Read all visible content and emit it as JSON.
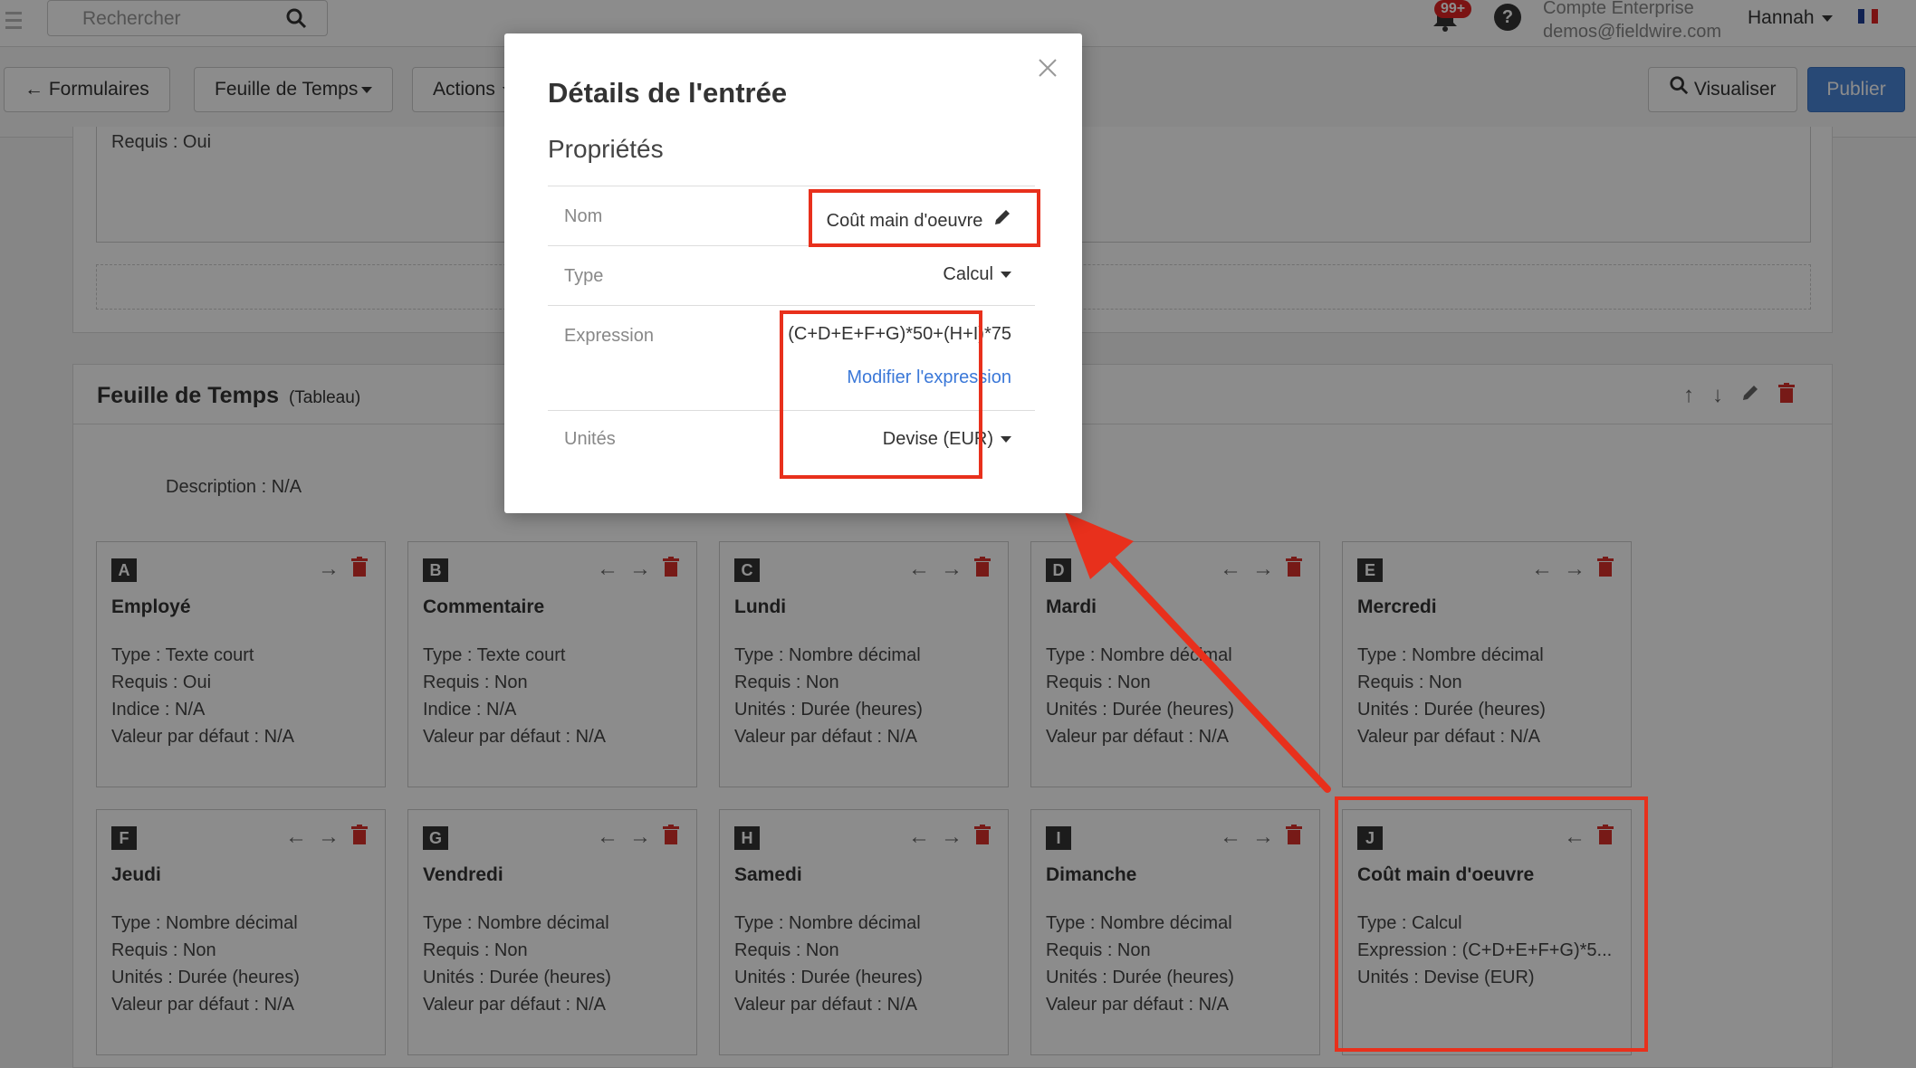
{
  "topbar": {
    "search_placeholder": "Rechercher",
    "notifications_badge": "99+",
    "help": "?",
    "account_name": "Compte Enterprise",
    "account_email": "demos@fieldwire.com",
    "user": "Hannah"
  },
  "toolbar": {
    "back_label": "Formulaires",
    "timesheet_label": "Feuille de Temps",
    "actions_label": "Actions",
    "preview_label": "Visualiser",
    "publish_label": "Publier"
  },
  "upper_section": {
    "required_text": "Requis : Oui"
  },
  "section": {
    "title": "Feuille de Temps",
    "subtitle": "(Tableau)",
    "description": "Description : N/A"
  },
  "cards": [
    {
      "letter": "A",
      "title": "Employé",
      "props": [
        "Type : Texte court",
        "Requis : Oui",
        "Indice : N/A",
        "Valeur par défaut : N/A"
      ]
    },
    {
      "letter": "B",
      "title": "Commentaire",
      "props": [
        "Type : Texte court",
        "Requis : Non",
        "Indice : N/A",
        "Valeur par défaut : N/A"
      ]
    },
    {
      "letter": "C",
      "title": "Lundi",
      "props": [
        "Type : Nombre décimal",
        "Requis : Non",
        "Unités : Durée (heures)",
        "Valeur par défaut : N/A"
      ]
    },
    {
      "letter": "D",
      "title": "Mardi",
      "props": [
        "Type : Nombre décimal",
        "Requis : Non",
        "Unités : Durée (heures)",
        "Valeur par défaut : N/A"
      ]
    },
    {
      "letter": "E",
      "title": "Mercredi",
      "props": [
        "Type : Nombre décimal",
        "Requis : Non",
        "Unités : Durée (heures)",
        "Valeur par défaut : N/A"
      ]
    },
    {
      "letter": "F",
      "title": "Jeudi",
      "props": [
        "Type : Nombre décimal",
        "Requis : Non",
        "Unités : Durée (heures)",
        "Valeur par défaut : N/A"
      ]
    },
    {
      "letter": "G",
      "title": "Vendredi",
      "props": [
        "Type : Nombre décimal",
        "Requis : Non",
        "Unités : Durée (heures)",
        "Valeur par défaut : N/A"
      ]
    },
    {
      "letter": "H",
      "title": "Samedi",
      "props": [
        "Type : Nombre décimal",
        "Requis : Non",
        "Unités : Durée (heures)",
        "Valeur par défaut : N/A"
      ]
    },
    {
      "letter": "I",
      "title": "Dimanche",
      "props": [
        "Type : Nombre décimal",
        "Requis : Non",
        "Unités : Durée (heures)",
        "Valeur par défaut : N/A"
      ]
    },
    {
      "letter": "J",
      "title": "Coût main d'oeuvre",
      "props": [
        "Type : Calcul",
        "Expression : (C+D+E+F+G)*5...",
        "Unités : Devise (EUR)"
      ]
    }
  ],
  "modal": {
    "title": "Détails de l'entrée",
    "subtitle": "Propriétés",
    "name_label": "Nom",
    "name_value": "Coût main d'oeuvre",
    "type_label": "Type",
    "type_value": "Calcul",
    "expression_label": "Expression",
    "expression_value": "(C+D+E+F+G)*50+(H+I)*75",
    "modify_expression": "Modifier l'expression",
    "units_label": "Unités",
    "units_value": "Devise (EUR)"
  },
  "colors": {
    "accent_blue": "#4a86d8",
    "link_blue": "#3b78d8",
    "annotation_red": "#e8301c",
    "delete_red": "#d9312b"
  }
}
